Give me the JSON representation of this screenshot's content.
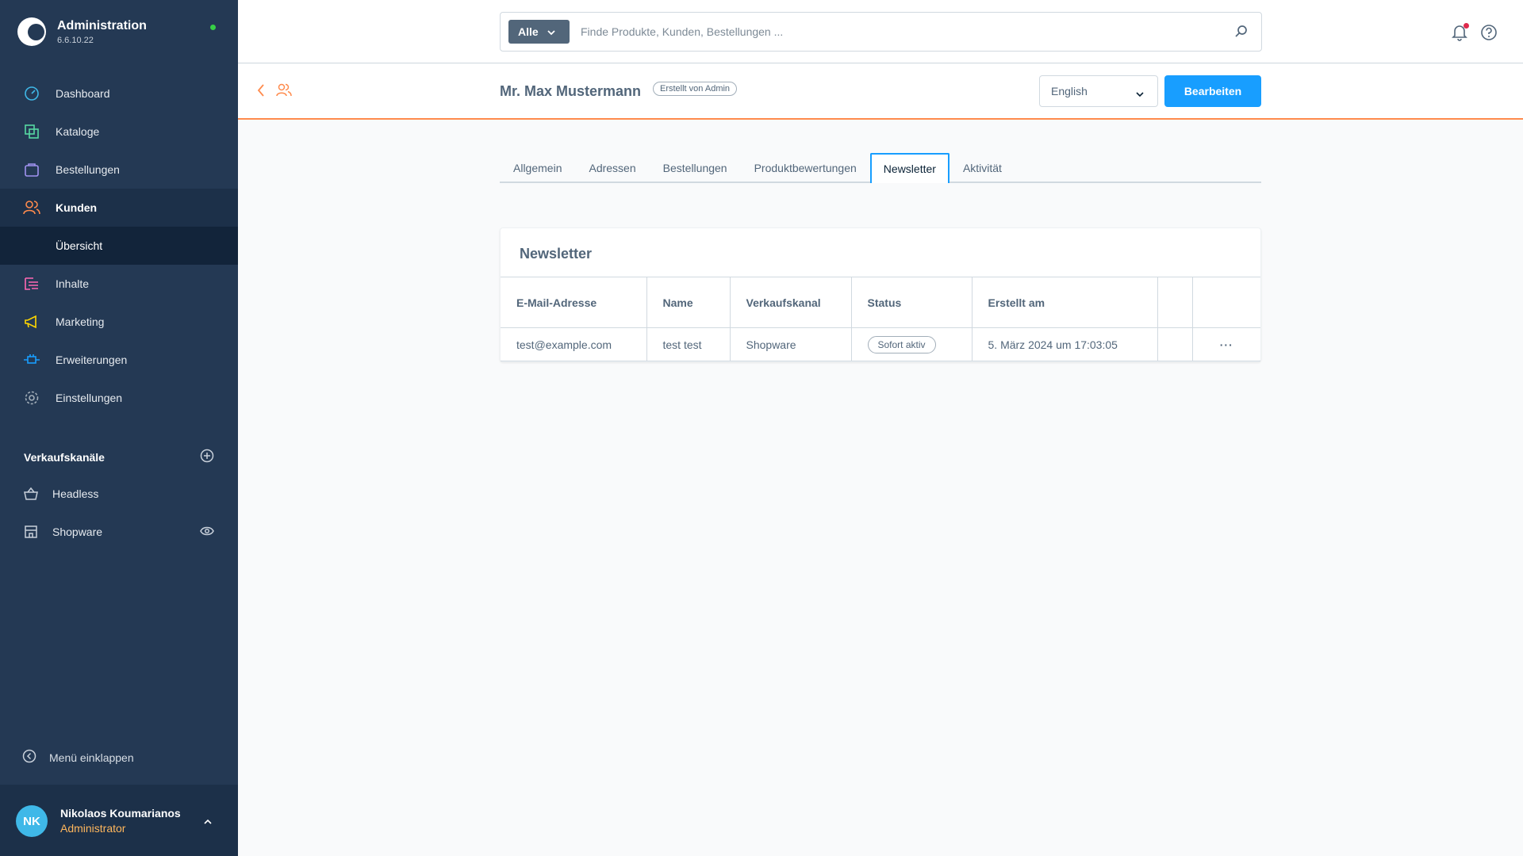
{
  "brand": {
    "title": "Administration",
    "version": "6.6.10.22"
  },
  "nav": {
    "items": [
      {
        "label": "Dashboard"
      },
      {
        "label": "Kataloge"
      },
      {
        "label": "Bestellungen"
      },
      {
        "label": "Kunden"
      },
      {
        "label": "Übersicht"
      },
      {
        "label": "Inhalte"
      },
      {
        "label": "Marketing"
      },
      {
        "label": "Erweiterungen"
      },
      {
        "label": "Einstellungen"
      }
    ]
  },
  "sales_channels": {
    "title": "Verkaufskanäle",
    "items": [
      {
        "label": "Headless"
      },
      {
        "label": "Shopware"
      }
    ]
  },
  "collapse_label": "Menü einklappen",
  "user": {
    "initials": "NK",
    "name": "Nikolaos Koumarianos",
    "role": "Administrator"
  },
  "search": {
    "type": "Alle",
    "placeholder": "Finde Produkte, Kunden, Bestellungen ..."
  },
  "smartbar": {
    "title": "Mr. Max Mustermann",
    "badge": "Erstellt von Admin",
    "language": "English",
    "edit_label": "Bearbeiten"
  },
  "tabs": [
    {
      "label": "Allgemein"
    },
    {
      "label": "Adressen"
    },
    {
      "label": "Bestellungen"
    },
    {
      "label": "Produktbewertungen"
    },
    {
      "label": "Newsletter"
    },
    {
      "label": "Aktivität"
    }
  ],
  "newsletter": {
    "title": "Newsletter",
    "columns": [
      "E-Mail-Adresse",
      "Name",
      "Verkaufskanal",
      "Status",
      "Erstellt am"
    ],
    "rows": [
      {
        "email": "test@example.com",
        "name": "test test",
        "channel": "Shopware",
        "status": "Sofort aktiv",
        "created": "5. März 2024 um 17:03:05",
        "actions": "···"
      }
    ]
  },
  "colors": {
    "sidebar": "#243954",
    "accent": "#189eff",
    "orange": "#ff8b4d"
  }
}
